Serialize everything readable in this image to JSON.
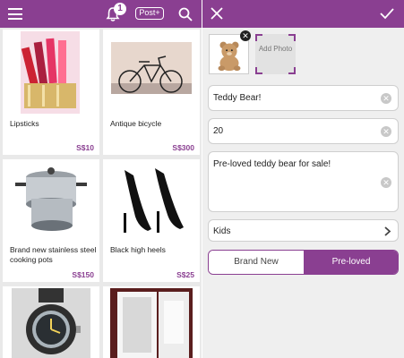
{
  "header": {
    "notification_count": "1",
    "post_label": "Post+"
  },
  "listings": [
    {
      "title": "Lipsticks",
      "price": "S$10"
    },
    {
      "title": "Antique bicycle",
      "price": "S$300"
    },
    {
      "title": "Brand new stainless steel cooking pots",
      "price": "S$150"
    },
    {
      "title": "Black high heels",
      "price": "S$25"
    },
    {
      "title": "",
      "price": ""
    },
    {
      "title": "",
      "price": ""
    }
  ],
  "form": {
    "add_photo_label": "Add Photo",
    "title_value": "Teddy Bear!",
    "price_value": "20",
    "description_value": "Pre-loved teddy bear for sale!",
    "category_value": "Kids",
    "condition_options": [
      "Brand New",
      "Pre-loved"
    ],
    "condition_selected": "Pre-loved"
  },
  "colors": {
    "accent": "#8a3f91"
  },
  "icons": [
    "menu-icon",
    "bell-icon",
    "search-icon",
    "close-icon",
    "check-icon",
    "clear-icon",
    "chevron-right-icon"
  ]
}
